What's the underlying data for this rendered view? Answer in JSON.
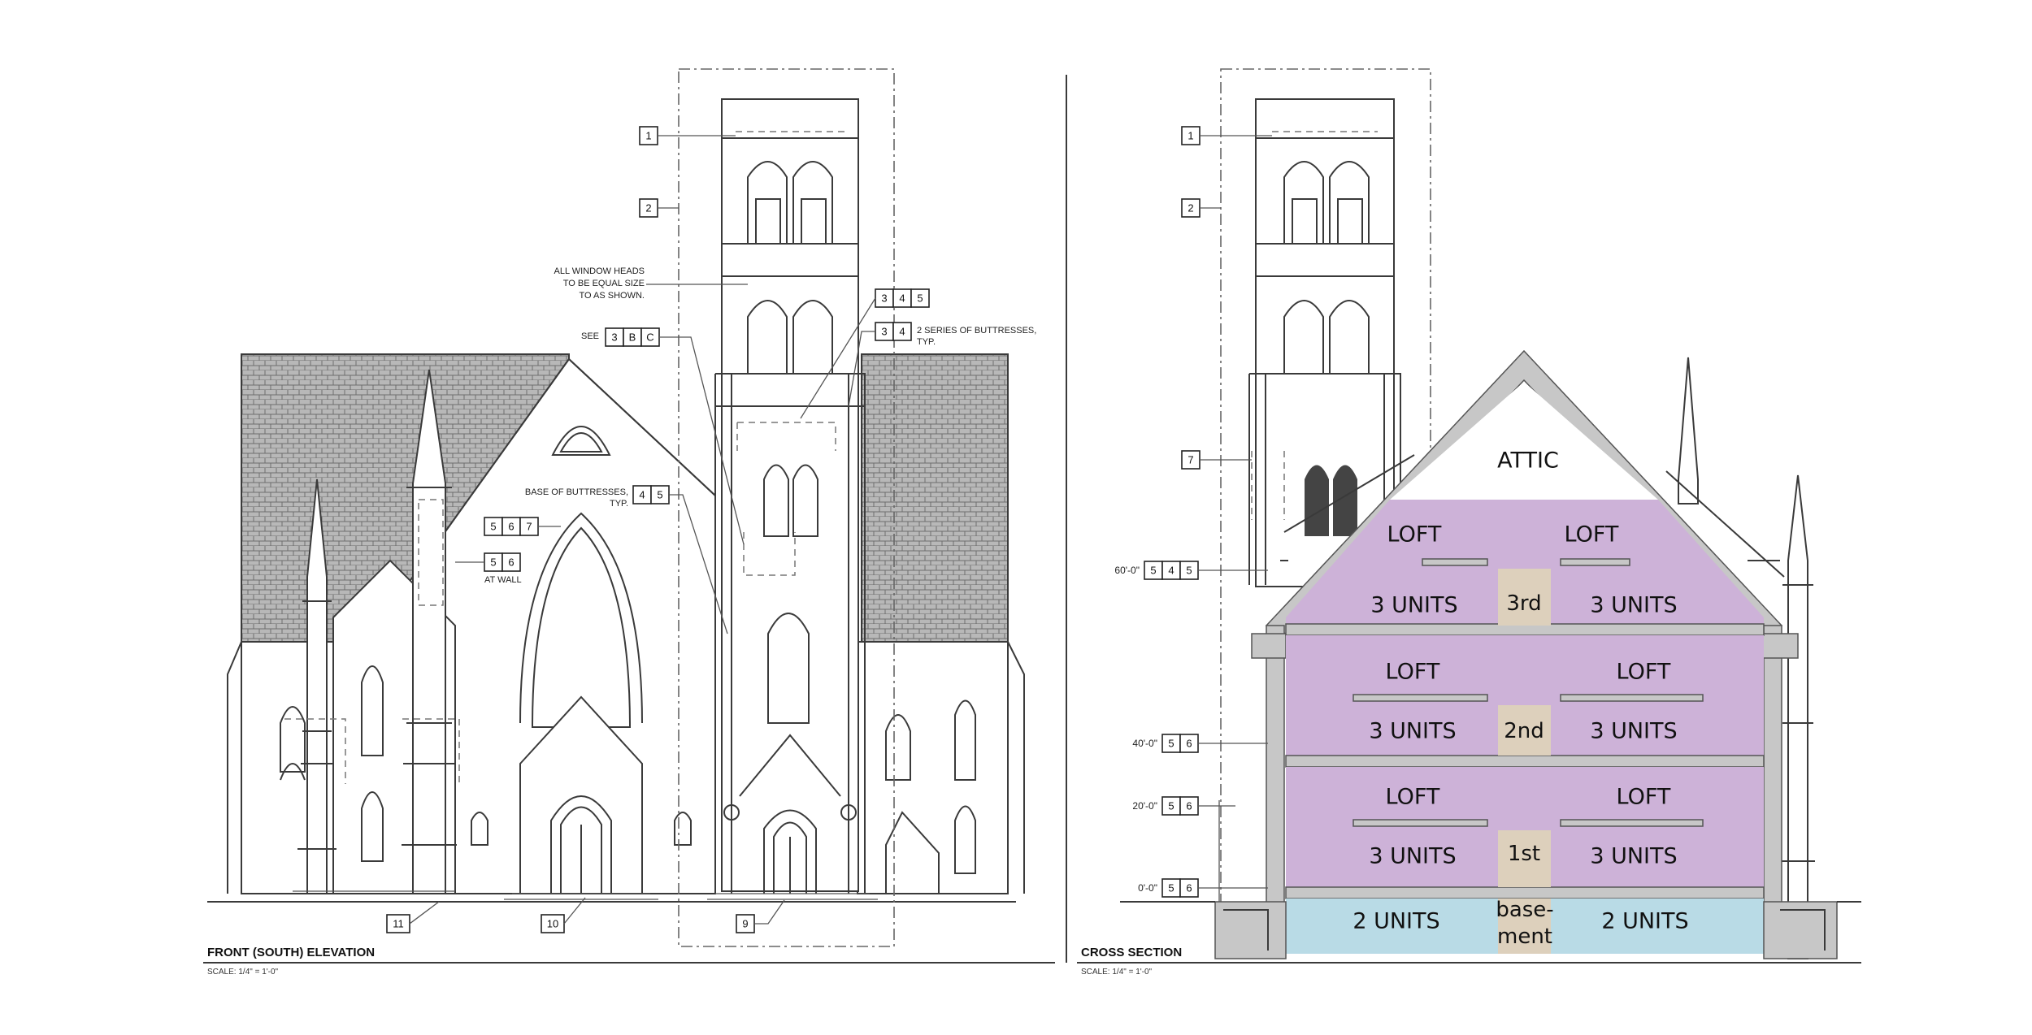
{
  "front_elevation": {
    "title": "FRONT (SOUTH) ELEVATION",
    "scale": "SCALE: 1/4\" = 1'-0\"",
    "notes": {
      "window_heads": [
        "ALL WINDOW HEADS",
        "TO BE EQUAL SIZE",
        "TO AS SHOWN."
      ],
      "see_prefix": "SEE",
      "buttress_series": [
        "2 SERIES OF BUTTRESSES,",
        "TYP."
      ],
      "buttress_base": [
        "BASE OF BUTTRESSES,",
        "TYP."
      ],
      "at_wall": "AT WALL"
    },
    "tags": {
      "t1": [
        "1"
      ],
      "t2": [
        "2"
      ],
      "t345": [
        "3",
        "4",
        "5"
      ],
      "t3bc": [
        "3",
        "B",
        "C"
      ],
      "t34": [
        "3",
        "4"
      ],
      "t45": [
        "4",
        "5"
      ],
      "t567": [
        "5",
        "6",
        "7"
      ],
      "t56": [
        "5",
        "6"
      ],
      "t11": [
        "11"
      ],
      "t10": [
        "10"
      ],
      "t9": [
        "9"
      ]
    }
  },
  "cross_section": {
    "title": "CROSS SECTION",
    "scale": "SCALE: 1/4\" = 1'-0\"",
    "attic": "ATTIC",
    "loft": "LOFT",
    "three_units": "3 UNITS",
    "two_units": "2 UNITS",
    "floors": {
      "third": "3rd",
      "second": "2nd",
      "first": "1st",
      "basement_1": "base-",
      "basement_2": "ment"
    },
    "levels": {
      "l60": "60'-0\"",
      "l40": "40'-0\"",
      "l20": "20'-0\"",
      "l0": "0'-0\""
    },
    "tags": {
      "t1": [
        "1"
      ],
      "t2": [
        "2"
      ],
      "t7": [
        "7"
      ],
      "t545": [
        "5",
        "4",
        "5"
      ],
      "t56a": [
        "5",
        "6"
      ],
      "t56b": [
        "5",
        "6"
      ],
      "t56c": [
        "5",
        "6"
      ]
    },
    "colors": {
      "units": "#cdb2d8",
      "basement_units": "#b9dbe6",
      "circulation": "#ddd0bc"
    }
  }
}
